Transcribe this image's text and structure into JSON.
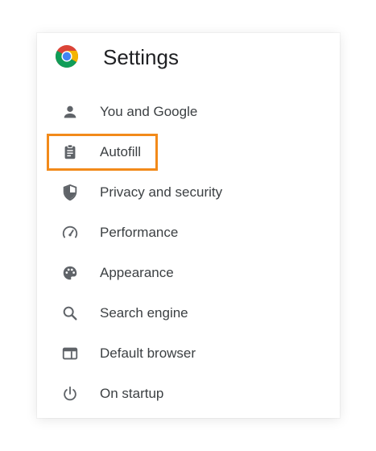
{
  "header": {
    "title": "Settings",
    "logo": "chrome-logo-icon"
  },
  "nav": {
    "items": [
      {
        "label": "You and Google",
        "icon": "person-icon"
      },
      {
        "label": "Autofill",
        "icon": "clipboard-icon",
        "highlighted": true
      },
      {
        "label": "Privacy and security",
        "icon": "shield-icon"
      },
      {
        "label": "Performance",
        "icon": "speedometer-icon"
      },
      {
        "label": "Appearance",
        "icon": "palette-icon"
      },
      {
        "label": "Search engine",
        "icon": "search-icon"
      },
      {
        "label": "Default browser",
        "icon": "browser-window-icon"
      },
      {
        "label": "On startup",
        "icon": "power-icon"
      }
    ]
  },
  "colors": {
    "highlight": "#f28a1a",
    "icon": "#5f6368",
    "text": "#3c4043",
    "title": "#202124"
  }
}
